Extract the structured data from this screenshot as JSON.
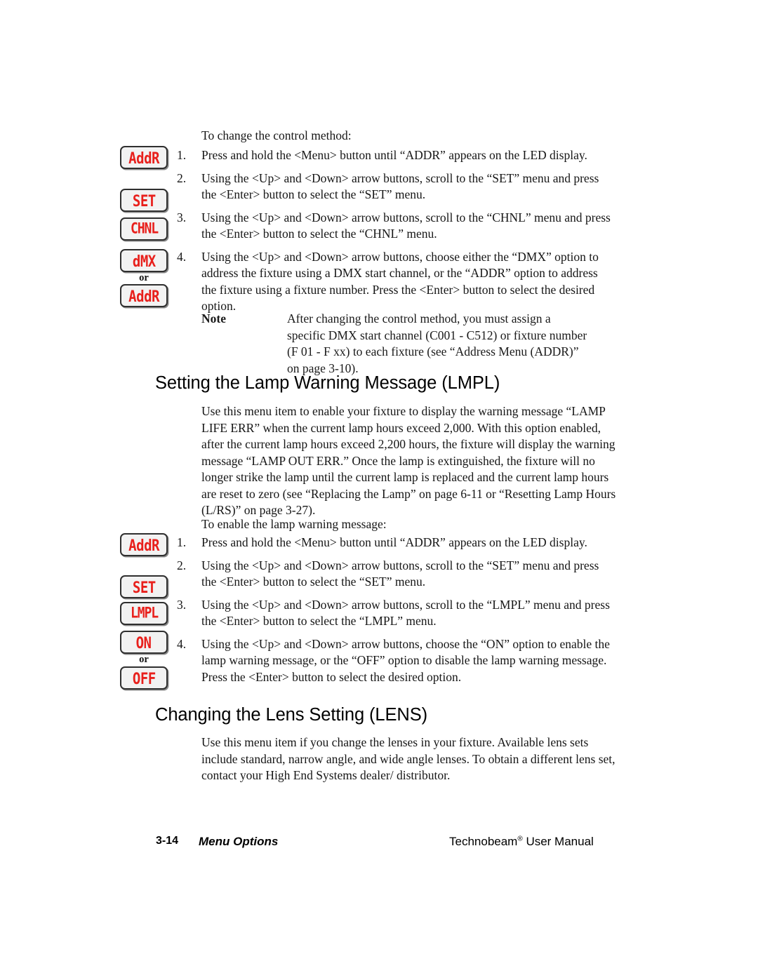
{
  "document": {
    "title": "Technobeam User Manual - Menu Options",
    "page_label": "3-14",
    "section_name": "Menu Options",
    "manual_name_part1": "Technobeam",
    "manual_registered": "®",
    "manual_name_part2": " User Manual"
  },
  "section_control_method": {
    "lead": "To change the control method:",
    "steps": [
      {
        "number": "1.",
        "text": "Press and hold the <Menu> button until “ADDR” appears on the LED display."
      },
      {
        "number": "2.",
        "text": "Using the <Up> and <Down> arrow buttons, scroll to the “SET” menu and press the <Enter> button to select the “SET” menu."
      },
      {
        "number": "3.",
        "text": "Using the <Up> and <Down> arrow buttons, scroll to the “CHNL” menu and press the <Enter> button to select the “CHNL” menu."
      },
      {
        "number": "4.",
        "text": "Using the <Up> and <Down> arrow buttons, choose either the “DMX” option to address the fixture using a DMX start channel, or the “ADDR” option to address the fixture using a fixture number.   Press the <Enter> button to select the desired option."
      }
    ],
    "led_displays": [
      {
        "value": "AddR",
        "step": "1"
      },
      {
        "value": "SET",
        "step": "2"
      },
      {
        "value": "CHNL",
        "step": "3"
      },
      {
        "value": "dMX",
        "step": "4"
      },
      {
        "value": "AddR",
        "step": "4"
      }
    ],
    "or_label": "or",
    "note": {
      "label": "Note",
      "text": "After changing the control method, you must assign a specific DMX start channel (C001 - C512) or fixture number (F 01 -  F xx) to each fixture (see “Address Menu (ADDR)” on page 3-10)."
    }
  },
  "section_lamp_warning": {
    "heading": "Setting the Lamp Warning Message (LMPL)",
    "paragraph": "Use this menu item to enable your fixture to display the warning message “LAMP LIFE ERR” when the current lamp hours exceed 2,000. With this option enabled, after the current lamp hours exceed 2,200 hours, the fixture will display the warning message “LAMP OUT ERR.” Once the lamp is extinguished, the fixture will no longer strike the lamp until the current lamp is replaced and the current lamp hours are reset to zero (see “Replacing the Lamp” on page 6-11 or “Resetting Lamp Hours (L/RS)” on page 3-27).",
    "lead": "To enable the lamp warning message:",
    "steps": [
      {
        "number": "1.",
        "text": "Press and hold the <Menu> button until “ADDR” appears on the LED display."
      },
      {
        "number": "2.",
        "text": "Using the <Up> and <Down> arrow buttons, scroll to the “SET” menu and press the <Enter> button to select the “SET” menu."
      },
      {
        "number": "3.",
        "text": "Using the <Up> and <Down> arrow buttons, scroll to the “LMPL” menu and press the <Enter> button to select the “LMPL” menu."
      },
      {
        "number": "4.",
        "text": "Using the <Up> and <Down> arrow buttons, choose the “ON” option to enable the lamp warning message, or the “OFF” option to disable the lamp warning message.   Press the <Enter> button to select the desired option."
      }
    ],
    "led_displays": [
      {
        "value": "AddR",
        "step": "1"
      },
      {
        "value": "SET",
        "step": "2"
      },
      {
        "value": "LMPL",
        "step": "3"
      },
      {
        "value": "ON",
        "step": "4"
      },
      {
        "value": "OFF",
        "step": "4"
      }
    ],
    "or_label": "or"
  },
  "section_lens": {
    "heading": "Changing the Lens Setting (LENS)",
    "paragraph": "Use this menu item if you change the lenses in your fixture.  Available lens sets include standard, narrow angle, and wide angle lenses.  To obtain a different lens set, contact your High End Systems dealer/ distributor."
  },
  "colors": {
    "led_text": "#e8201c",
    "led_border": "#2f2f2f",
    "led_background": "#f2f2f2",
    "body_text": "#161616"
  }
}
